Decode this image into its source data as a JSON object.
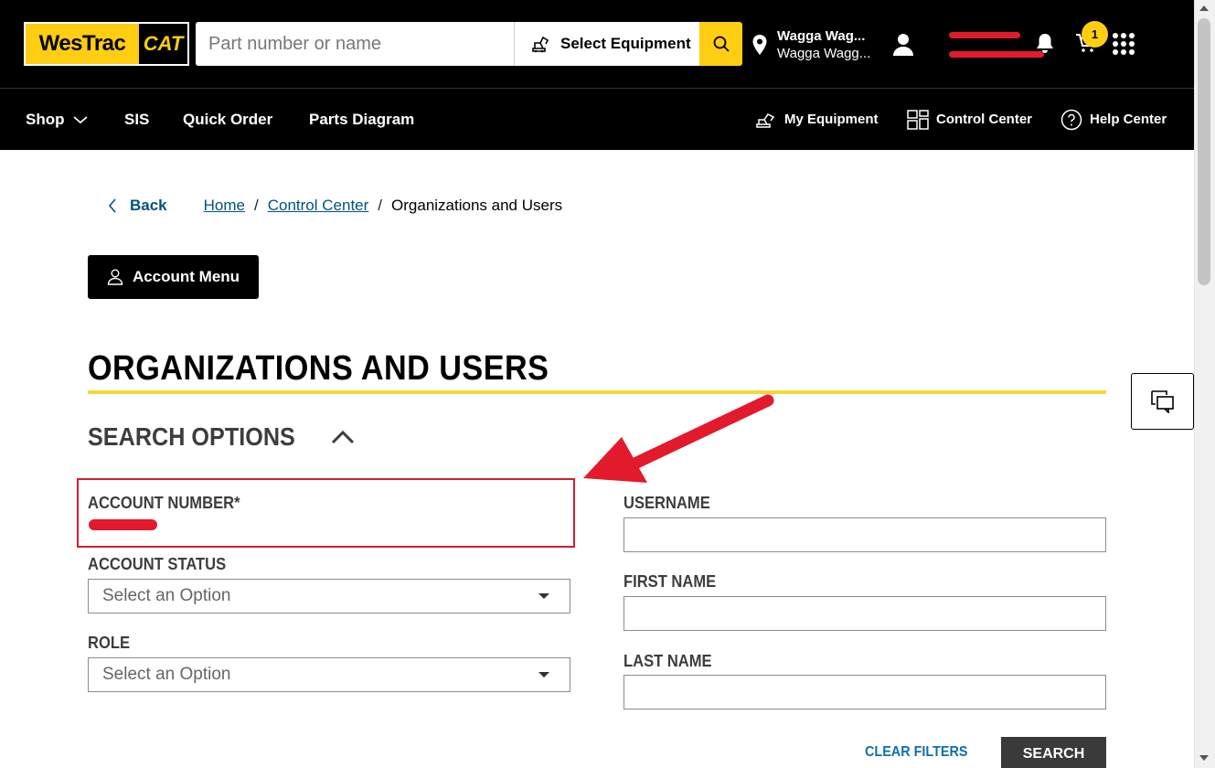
{
  "header": {
    "logo_westrac": "WesTrac",
    "logo_cat": "CAT",
    "search_placeholder": "Part number or name",
    "select_equipment_label": "Select Equipment",
    "location_line1": "Wagga Wag...",
    "location_line2": "Wagga Wagg...",
    "cart_count": "1"
  },
  "nav": {
    "shop": "Shop",
    "sis": "SIS",
    "quick_order": "Quick Order",
    "parts_diagram": "Parts Diagram",
    "my_equipment": "My Equipment",
    "control_center": "Control Center",
    "help_center": "Help Center"
  },
  "breadcrumb": {
    "back": "Back",
    "home": "Home",
    "control_center": "Control Center",
    "current": "Organizations and Users",
    "separator": "/"
  },
  "account_menu_label": "Account Menu",
  "page_title": "ORGANIZATIONS AND USERS",
  "search_options_label": "SEARCH OPTIONS",
  "form": {
    "account_number_label": "ACCOUNT NUMBER*",
    "account_status_label": "ACCOUNT STATUS",
    "account_status_value": "Select an Option",
    "role_label": "ROLE",
    "role_value": "Select an Option",
    "username_label": "USERNAME",
    "first_name_label": "FIRST NAME",
    "last_name_label": "LAST NAME",
    "clear_filters": "CLEAR FILTERS",
    "search": "SEARCH"
  },
  "colors": {
    "brand_yellow": "#ffcd11",
    "link_blue": "#00527c",
    "annotation_red": "#d01f2e",
    "title_rule": "#f5d73a"
  }
}
